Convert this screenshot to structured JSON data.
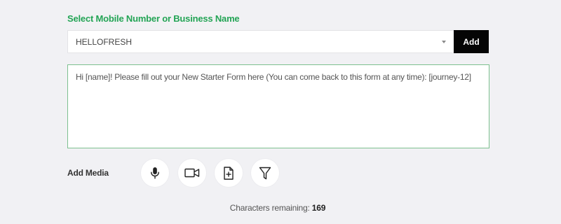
{
  "select_label": "Select Mobile Number or Business Name",
  "sender": {
    "value": "HELLOFRESH",
    "add_label": "Add"
  },
  "message": {
    "text": "Hi [name]! Please fill out your New Starter Form here (You can come back to this form at any time): [journey-12]"
  },
  "media": {
    "label": "Add Media",
    "buttons": [
      {
        "icon": "microphone-icon"
      },
      {
        "icon": "video-camera-icon"
      },
      {
        "icon": "add-document-icon"
      },
      {
        "icon": "filter-icon"
      }
    ]
  },
  "characters": {
    "label": "Characters remaining:",
    "count": "169"
  },
  "colors": {
    "accent": "#23a455",
    "add_button": "#050505",
    "background": "#f1f1f4"
  }
}
